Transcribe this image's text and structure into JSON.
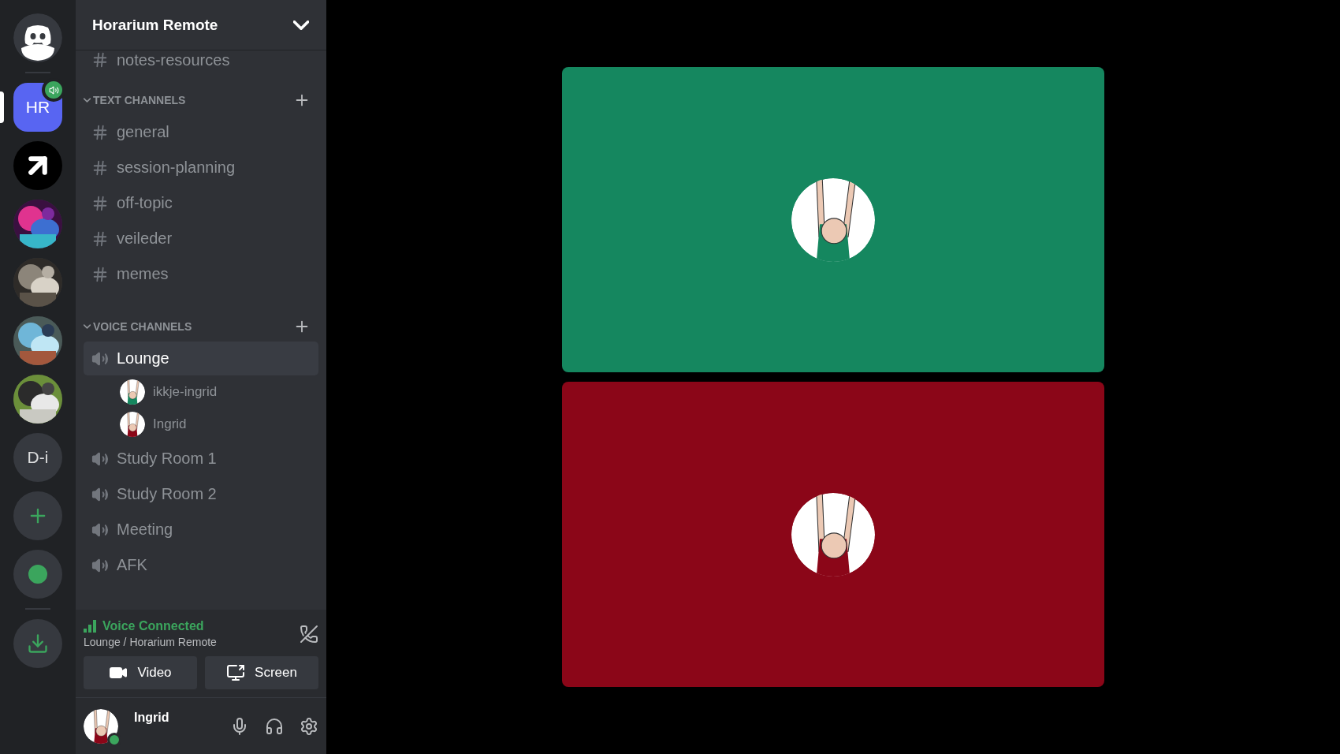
{
  "servers": [
    {
      "kind": "home"
    },
    {
      "kind": "initials",
      "label": "HR",
      "selected": true,
      "voice_active": true
    },
    {
      "kind": "arrow",
      "selected": false
    },
    {
      "kind": "picture",
      "selected": false
    },
    {
      "kind": "picture",
      "selected": false
    },
    {
      "kind": "picture",
      "selected": false
    },
    {
      "kind": "picture",
      "selected": false
    },
    {
      "kind": "initials",
      "label": "D-i",
      "selected": false,
      "voice_active": false
    },
    {
      "kind": "add"
    },
    {
      "kind": "explore"
    },
    {
      "kind": "download"
    }
  ],
  "server_header": {
    "title": "Horarium Remote"
  },
  "scrolled_channel": {
    "name": "notes-resources"
  },
  "categories": [
    {
      "title": "TEXT CHANNELS",
      "kind": "text",
      "channels": [
        {
          "name": "general",
          "selected": false
        },
        {
          "name": "session-planning",
          "selected": false
        },
        {
          "name": "off-topic",
          "selected": false
        },
        {
          "name": "veileder",
          "selected": false
        },
        {
          "name": "memes",
          "selected": false
        }
      ]
    },
    {
      "title": "VOICE CHANNELS",
      "kind": "voice",
      "channels": [
        {
          "name": "Lounge",
          "selected": true,
          "children": [
            {
              "name": "ikkje-ingrid",
              "color": "#15875f"
            },
            {
              "name": "Ingrid",
              "color": "#8b0618"
            }
          ]
        },
        {
          "name": "Study Room 1",
          "selected": false
        },
        {
          "name": "Study Room 2",
          "selected": false
        },
        {
          "name": "Meeting",
          "selected": false
        },
        {
          "name": "AFK",
          "selected": false
        }
      ]
    }
  ],
  "voice_panel": {
    "status": "Voice Connected",
    "location": "Lounge / Horarium Remote",
    "buttons": [
      "Video",
      "Screen"
    ]
  },
  "user_panel": {
    "name": "Ingrid",
    "online": true
  },
  "tiles": [
    {
      "color": "#15875f"
    },
    {
      "color": "#8b0618"
    }
  ]
}
